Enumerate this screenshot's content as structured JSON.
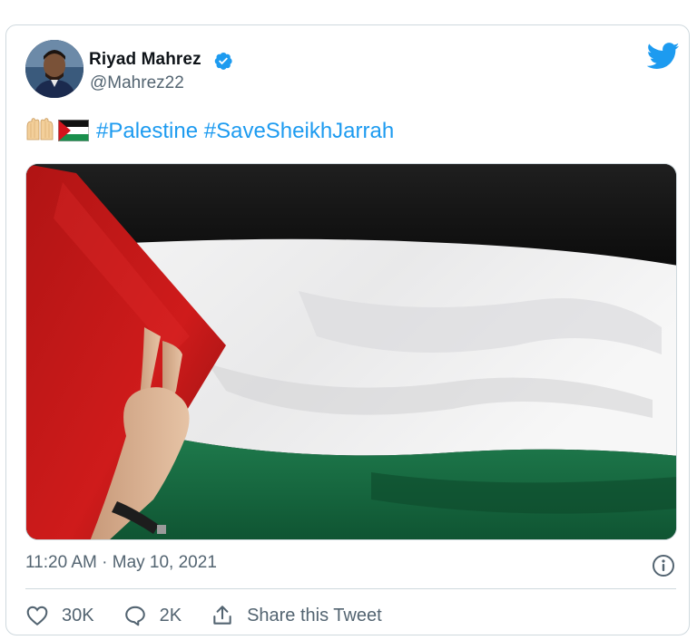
{
  "user": {
    "name": "Riyad Mahrez",
    "handle": "@Mahrez22",
    "verified": true
  },
  "tweet": {
    "hashtags": [
      "#Palestine",
      "#SaveSheikhJarrah"
    ],
    "emojis": [
      "palms-up-together",
      "palestine-flag"
    ],
    "timestamp": "11:20 AM · May 10, 2021"
  },
  "media": {
    "icon": "palestine-flag-photo"
  },
  "actions": {
    "likes": "30K",
    "replies": "2K",
    "share_label": "Share this Tweet"
  },
  "colors": {
    "accent": "#1d9bf0",
    "muted_text": "#536471",
    "border": "#cfd9de"
  }
}
